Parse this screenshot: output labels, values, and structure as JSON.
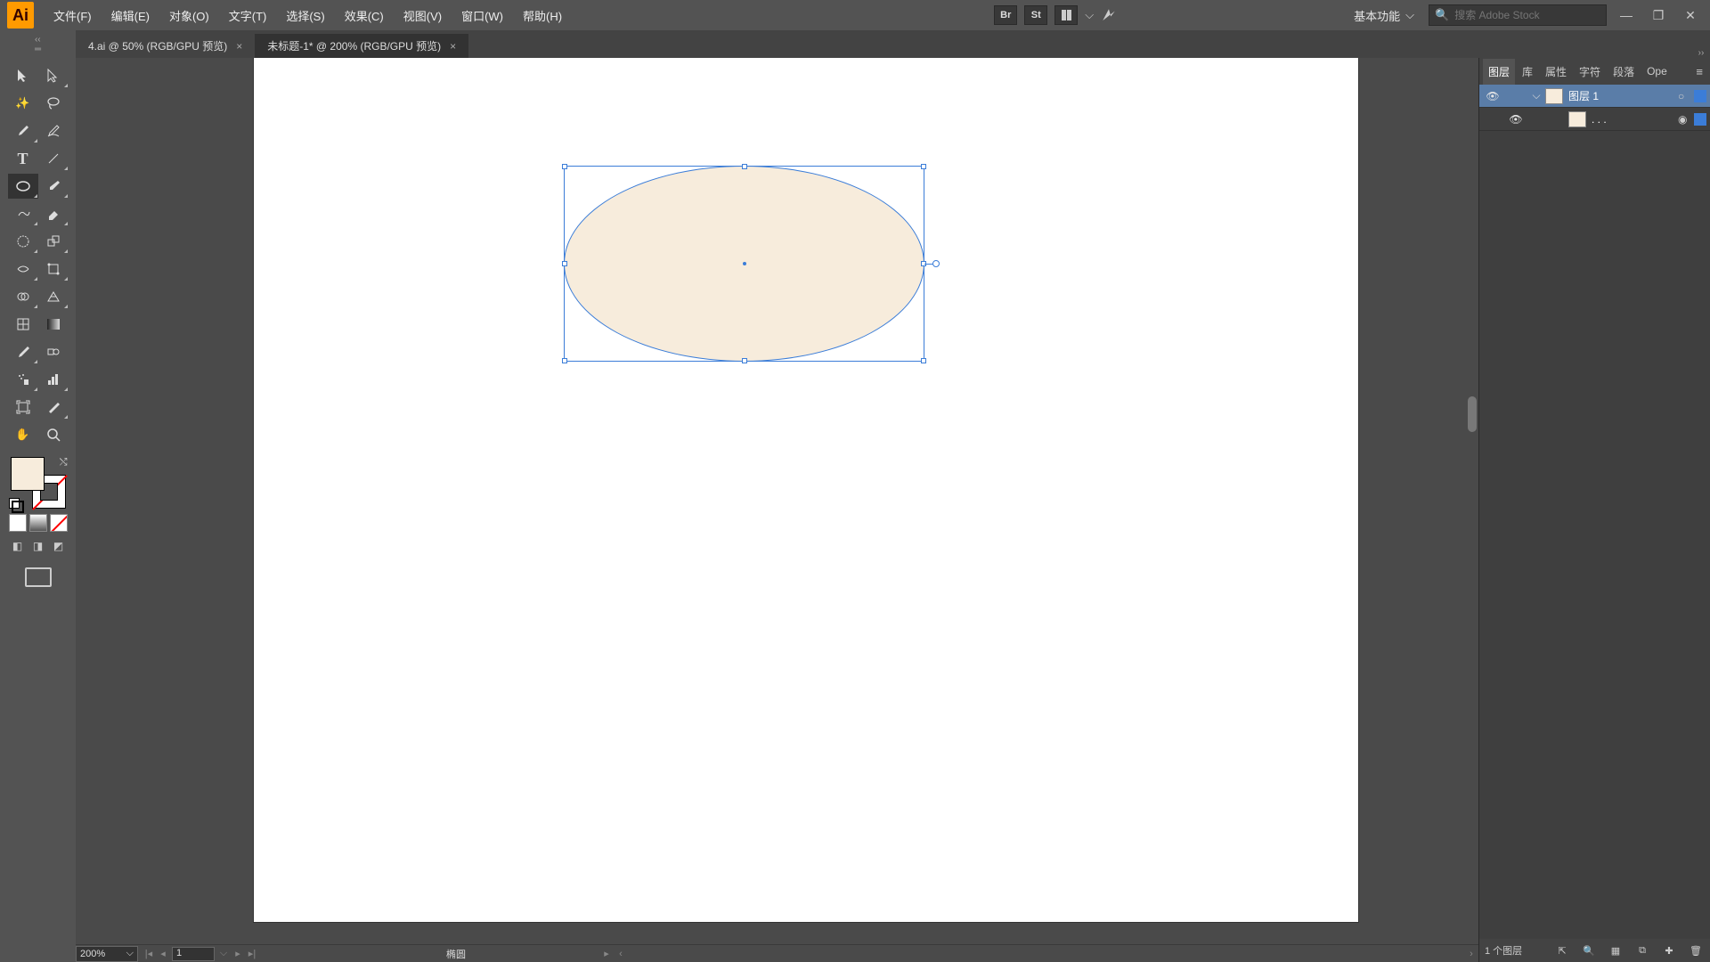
{
  "menu": {
    "file": "文件(F)",
    "edit": "编辑(E)",
    "object": "对象(O)",
    "type": "文字(T)",
    "select": "选择(S)",
    "effect": "效果(C)",
    "view": "视图(V)",
    "window": "窗口(W)",
    "help": "帮助(H)"
  },
  "topbar": {
    "br": "Br",
    "st": "St",
    "workspace": "基本功能",
    "search_ph": "搜索 Adobe Stock"
  },
  "tabs": {
    "t1": "4.ai @ 50% (RGB/GPU 预览)",
    "t2": "未标题-1* @ 200% (RGB/GPU 预览)"
  },
  "status": {
    "zoom": "200%",
    "page": "1",
    "selection": "椭圆",
    "layersCount": "1 个图层"
  },
  "panels": {
    "layers": "图层",
    "lib": "库",
    "props": "属性",
    "char": "字符",
    "para": "段落",
    "open": "Ope"
  },
  "layer": {
    "name": "图层 1",
    "sub": ". . ."
  }
}
